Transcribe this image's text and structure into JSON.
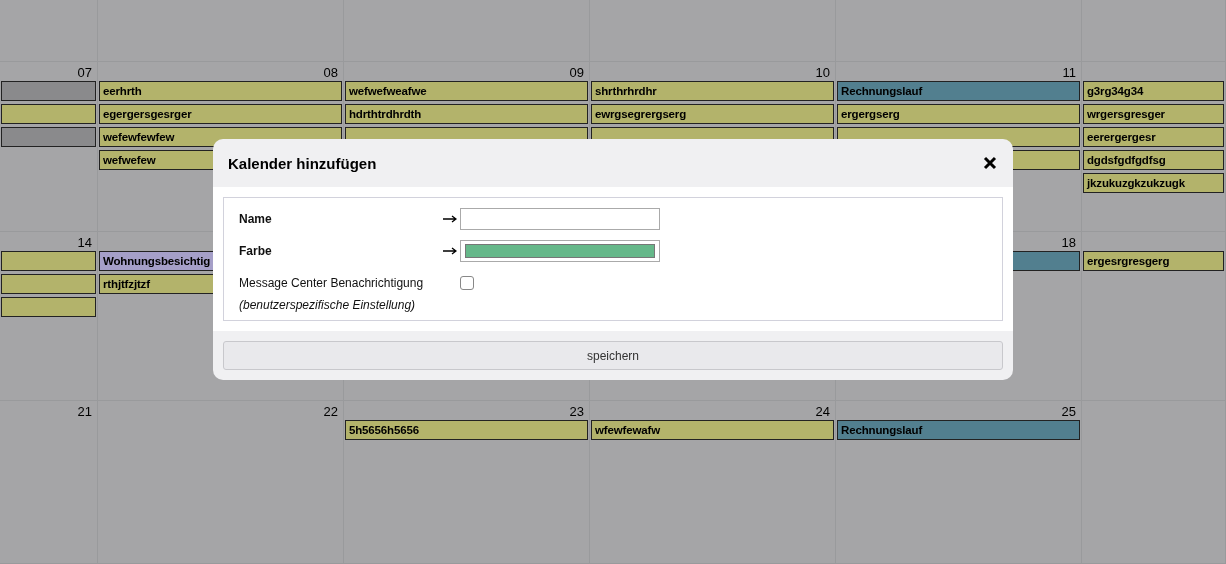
{
  "calendar": {
    "weeks": [
      {
        "column_1": {
          "number": "07",
          "events": [
            {
              "color": "#8a8a8c"
            },
            {
              "color": "#b3b36b"
            },
            {
              "color": "#8a8a8c"
            }
          ]
        },
        "column_2": {
          "number": "08",
          "events": [
            {
              "title": "eerhrth",
              "color": "#b3b36b"
            },
            {
              "title": "egergersgesrger",
              "color": "#b3b36b"
            },
            {
              "title": "wefewfewfew",
              "color": "#b3b36b"
            },
            {
              "title": "wefwefew",
              "color": "#b3b36b"
            }
          ]
        },
        "column_3": {
          "number": "09",
          "events": [
            {
              "title": "wefwefweafwe",
              "color": "#b3b36b"
            },
            {
              "title": "hdrthtrdhrdth",
              "color": "#b3b36b"
            },
            {
              "color": "#b3b36b"
            }
          ]
        },
        "column_4": {
          "number": "10",
          "events": [
            {
              "title": "shrthrhrdhr",
              "color": "#b3b36b"
            },
            {
              "title": "ewrgsegrergserg",
              "color": "#b3b36b"
            },
            {
              "color": "#b3b36b"
            }
          ]
        },
        "column_5": {
          "number": "11",
          "events": [
            {
              "title": "Rechnungslauf",
              "color": "#527f8f"
            },
            {
              "title": "ergergserg",
              "color": "#b3b36b"
            },
            {
              "color": "#b3b36b"
            },
            {
              "color": "#b3b36b"
            }
          ]
        },
        "column_6": {
          "events": [
            {
              "title": "g3rg34g34",
              "color": "#b3b36b"
            },
            {
              "title": "wrgersgresger",
              "color": "#b3b36b"
            },
            {
              "title": "eerergergesr",
              "color": "#b3b36b"
            },
            {
              "title": "dgdsfgdfgdfsg",
              "color": "#b3b36b"
            },
            {
              "title": "jkzukuzgkzukzugk",
              "color": "#b3b36b"
            }
          ]
        }
      },
      {
        "column_1": {
          "number": "14",
          "events": [
            {
              "color": "#b3b36b"
            },
            {
              "color": "#b3b36b"
            },
            {
              "color": "#b3b36b"
            }
          ]
        },
        "column_2": {
          "events": [
            {
              "title": "Wohnungsbesichtig",
              "color": "#a59fc8"
            },
            {
              "title": "rthjtfzjtzf",
              "color": "#b3b36b"
            }
          ]
        },
        "column_5": {
          "number": "18",
          "events": [
            {
              "color": "#527f8f"
            }
          ]
        },
        "column_6": {
          "events": [
            {
              "title": "ergesrgresgerg",
              "color": "#b3b36b"
            }
          ]
        }
      },
      {
        "column_1": {
          "number": "21"
        },
        "column_2": {
          "number": "22"
        },
        "column_3": {
          "number": "23",
          "events": [
            {
              "title": "5h5656h5656",
              "color": "#b3b36b"
            }
          ]
        },
        "column_4": {
          "number": "24",
          "events": [
            {
              "title": "wfewfewafw",
              "color": "#b3b36b"
            }
          ]
        },
        "column_5": {
          "number": "25",
          "events": [
            {
              "title": "Rechnungslauf",
              "color": "#527f8f"
            }
          ]
        }
      }
    ]
  },
  "dialog": {
    "title": "Kalender hinzufügen",
    "fields": [
      {
        "kind": "text",
        "label": "Name"
      },
      {
        "kind": "color",
        "label": "Farbe",
        "color": "#66b88a"
      },
      {
        "kind": "checkbox",
        "label": "Message Center Benachrichtigung",
        "checked": false,
        "hint": "(benutzerspezifische Einstellung)"
      }
    ],
    "button": "speichern"
  }
}
